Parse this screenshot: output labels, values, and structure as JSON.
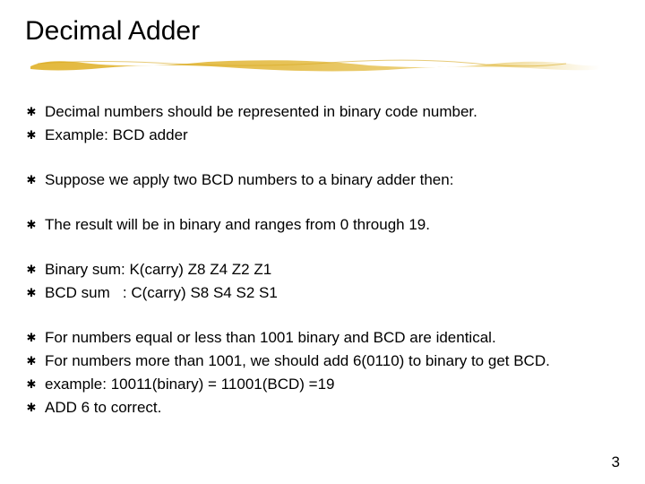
{
  "title": "Decimal Adder",
  "bullet_glyph": "✱",
  "groups": [
    [
      "Decimal numbers should be represented in binary code number.",
      "Example: BCD adder"
    ],
    [
      "Suppose we apply two BCD numbers to a binary adder then:"
    ],
    [
      "The result will be in binary and ranges from 0 through 19."
    ],
    [
      "Binary sum: K(carry) Z8 Z4 Z2 Z1",
      "BCD sum   : C(carry) S8 S4 S2 S1"
    ],
    [
      "For numbers equal or less than 1001 binary and BCD are identical.",
      "For numbers more than 1001, we should add 6(0110) to binary to get BCD.",
      "example: 10011(binary) = 11001(BCD) =19",
      "ADD 6 to correct."
    ]
  ],
  "page_number": "3"
}
